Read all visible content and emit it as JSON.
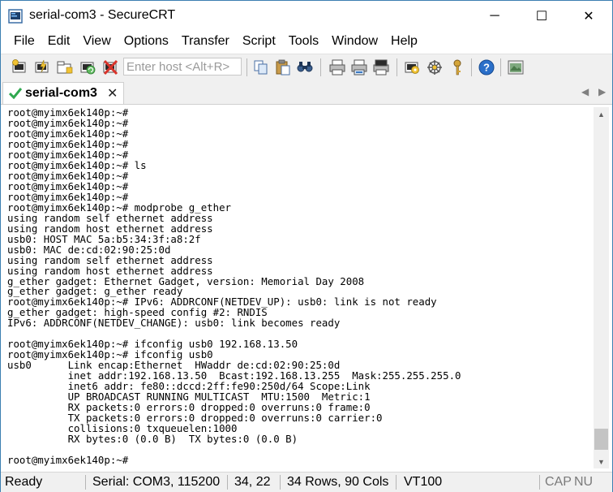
{
  "window": {
    "title": "serial-com3 - SecureCRT",
    "minimize_glyph": "─",
    "maximize_glyph": "☐",
    "close_glyph": "✕"
  },
  "menu": [
    "File",
    "Edit",
    "View",
    "Options",
    "Transfer",
    "Script",
    "Tools",
    "Window",
    "Help"
  ],
  "toolbar": {
    "host_placeholder": "Enter host <Alt+R>",
    "icons": [
      "connect-icon",
      "quick-connect-icon",
      "connect-in-tab-icon",
      "reconnect-icon",
      "disconnect-icon",
      "copy-icon",
      "paste-icon",
      "find-icon",
      "print-icon",
      "print-selection-icon",
      "print-screen-icon",
      "session-options-icon",
      "global-options-icon",
      "keymap-icon",
      "help-icon",
      "about-icon"
    ]
  },
  "tab": {
    "label": "serial-com3",
    "close_glyph": "✕",
    "status_icon": "check-icon"
  },
  "terminal": {
    "lines": [
      "root@myimx6ek140p:~#",
      "root@myimx6ek140p:~#",
      "root@myimx6ek140p:~#",
      "root@myimx6ek140p:~#",
      "root@myimx6ek140p:~#",
      "root@myimx6ek140p:~# ls",
      "root@myimx6ek140p:~#",
      "root@myimx6ek140p:~#",
      "root@myimx6ek140p:~#",
      "root@myimx6ek140p:~# modprobe g_ether",
      "using random self ethernet address",
      "using random host ethernet address",
      "usb0: HOST MAC 5a:b5:34:3f:a8:2f",
      "usb0: MAC de:cd:02:90:25:0d",
      "using random self ethernet address",
      "using random host ethernet address",
      "g_ether gadget: Ethernet Gadget, version: Memorial Day 2008",
      "g_ether gadget: g_ether ready",
      "root@myimx6ek140p:~# IPv6: ADDRCONF(NETDEV_UP): usb0: link is not ready",
      "g_ether gadget: high-speed config #2: RNDIS",
      "IPv6: ADDRCONF(NETDEV_CHANGE): usb0: link becomes ready",
      "",
      "root@myimx6ek140p:~# ifconfig usb0 192.168.13.50",
      "root@myimx6ek140p:~# ifconfig usb0",
      "usb0      Link encap:Ethernet  HWaddr de:cd:02:90:25:0d",
      "          inet addr:192.168.13.50  Bcast:192.168.13.255  Mask:255.255.255.0",
      "          inet6 addr: fe80::dccd:2ff:fe90:250d/64 Scope:Link",
      "          UP BROADCAST RUNNING MULTICAST  MTU:1500  Metric:1",
      "          RX packets:0 errors:0 dropped:0 overruns:0 frame:0",
      "          TX packets:0 errors:0 dropped:0 overruns:0 carrier:0",
      "          collisions:0 txqueuelen:1000",
      "          RX bytes:0 (0.0 B)  TX bytes:0 (0.0 B)",
      "",
      "root@myimx6ek140p:~#"
    ]
  },
  "status": {
    "ready": "Ready",
    "connection": "Serial: COM3, 115200",
    "cursor": "34,  22",
    "size": "34 Rows, 90 Cols",
    "emulation": "VT100",
    "caps": "CAP",
    "num": "NU"
  },
  "colors": {
    "accent": "#0078d7",
    "green_check": "#2fa84f",
    "window_border": "#3c7fb1"
  }
}
